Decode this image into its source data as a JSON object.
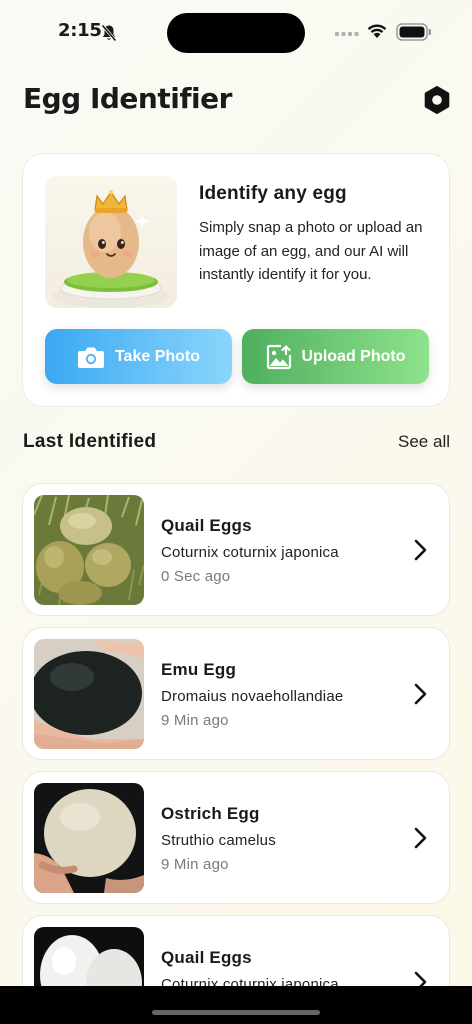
{
  "status": {
    "time": "2:15"
  },
  "header": {
    "title": "Egg Identifier"
  },
  "hero": {
    "heading": "Identify any egg",
    "description": "Simply snap a photo or upload an image of an egg, and our AI will instantly identify it for you.",
    "take_photo_label": "Take Photo",
    "upload_photo_label": "Upload Photo"
  },
  "section": {
    "title": "Last Identified",
    "see_all": "See all"
  },
  "items": [
    {
      "name": "Quail Eggs",
      "scientific": "Coturnix coturnix japonica",
      "time": "0 Sec ago"
    },
    {
      "name": "Emu Egg",
      "scientific": "Dromaius novaehollandiae",
      "time": "9 Min ago"
    },
    {
      "name": "Ostrich Egg",
      "scientific": "Struthio camelus",
      "time": "9 Min ago"
    },
    {
      "name": "Quail Eggs",
      "scientific": "Coturnix coturnix japonica",
      "time": ""
    }
  ],
  "icons": {
    "settings": "settings-icon",
    "camera": "camera-icon",
    "upload": "image-upload-icon",
    "chevron": "chevron-right-icon"
  },
  "colors": {
    "take_photo": "#3aa8f2",
    "upload_photo": "#4faf5f"
  }
}
